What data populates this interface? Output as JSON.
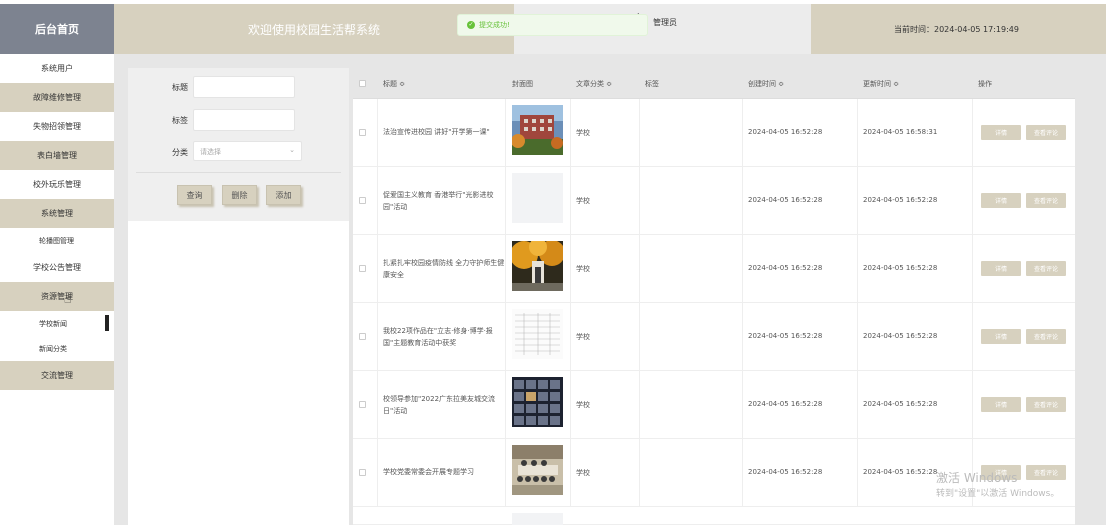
{
  "header": {
    "brand": "后台首页",
    "welcome": "欢迎使用校园生活帮系统",
    "role": "管理员",
    "time_label": "当前时间：2024-04-05 17:19:49"
  },
  "toast": {
    "message": "提交成功!"
  },
  "sidebar": {
    "items": [
      {
        "label": "系统用户"
      },
      {
        "label": "故障维修管理"
      },
      {
        "label": "失物招领管理"
      },
      {
        "label": "表白墙管理"
      },
      {
        "label": "校外玩乐管理"
      },
      {
        "label": "系统管理"
      },
      {
        "label": "轮播图管理"
      },
      {
        "label": "学校公告管理"
      },
      {
        "label": "资源管理"
      },
      {
        "label": "学校新闻"
      },
      {
        "label": "新闻分类"
      },
      {
        "label": "交流管理"
      }
    ]
  },
  "filter": {
    "title_label": "标题",
    "tag_label": "标签",
    "category_label": "分类",
    "category_placeholder": "请选择",
    "query": "查询",
    "delete": "删除",
    "add": "添加"
  },
  "table": {
    "headers": {
      "title": "标题 ≎",
      "cover": "封面图",
      "category": "文章分类 ≎",
      "tag": "标签",
      "created": "创建时间 ≎",
      "updated": "更新时间 ≎",
      "actions": "操作"
    },
    "detail_label": "详情",
    "comment_label": "查看评论",
    "rows": [
      {
        "title": "法治宣传进校园 讲好\"开学第一课\"",
        "category": "学校",
        "created": "2024-04-05 16:52:28",
        "updated": "2024-04-05 16:58:31",
        "thumb": "campus-building"
      },
      {
        "title": "促爱国主义教育 香港举行\"光影进校园\"活动",
        "category": "学校",
        "created": "2024-04-05 16:52:28",
        "updated": "2024-04-05 16:52:28",
        "thumb": "blank"
      },
      {
        "title": "扎紧扎牢校园疫情防线 全力守护师生健康安全",
        "category": "学校",
        "created": "2024-04-05 16:52:28",
        "updated": "2024-04-05 16:52:28",
        "thumb": "autumn-gate"
      },
      {
        "title": "我校22项作品在\"立志·修身·博学·报国\"主题教育活动中获奖",
        "category": "学校",
        "created": "2024-04-05 16:52:28",
        "updated": "2024-04-05 16:52:28",
        "thumb": "document"
      },
      {
        "title": "校领导参加\"2022广东拉美友城交流日\"活动",
        "category": "学校",
        "created": "2024-04-05 16:52:28",
        "updated": "2024-04-05 16:52:28",
        "thumb": "video-grid"
      },
      {
        "title": "学校党委常委会开展专题学习",
        "category": "学校",
        "created": "2024-04-05 16:52:28",
        "updated": "2024-04-05 16:52:28",
        "thumb": "meeting"
      }
    ]
  },
  "watermark": {
    "line1": "激活 Windows",
    "line2": "转到\"设置\"以激活 Windows。"
  },
  "colors": {
    "accent": "#d7d1bf",
    "brand": "#7d8390",
    "success": "#67c23a"
  }
}
